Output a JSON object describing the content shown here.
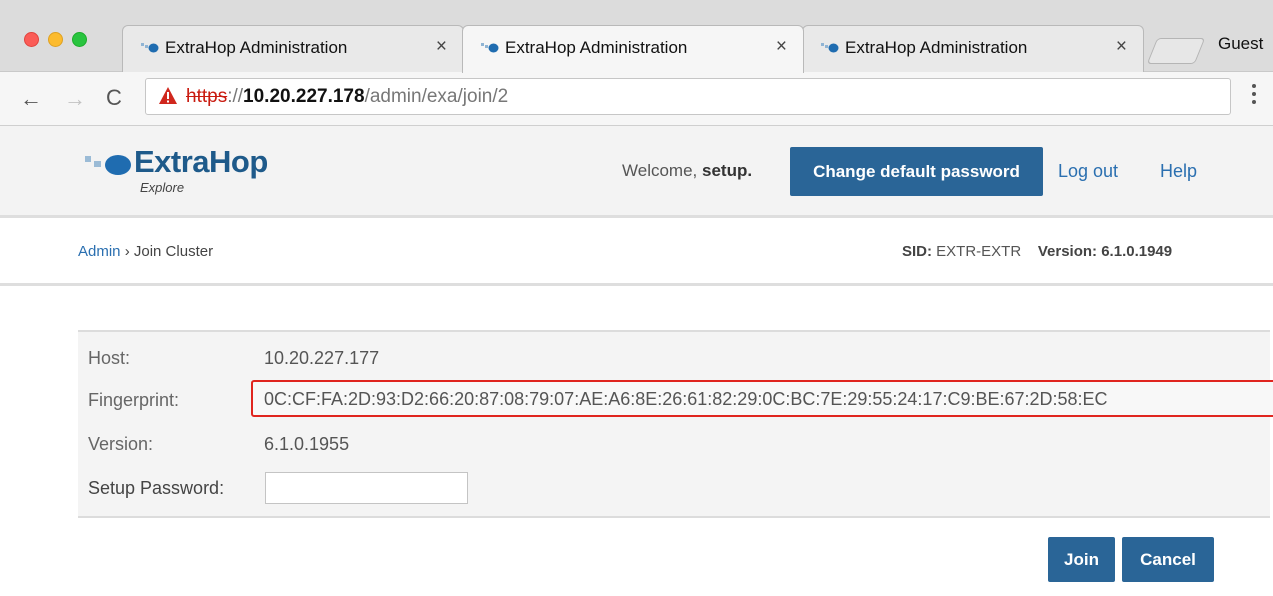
{
  "browser": {
    "tabs": [
      {
        "title": "ExtraHop Administration",
        "close": "×"
      },
      {
        "title": "ExtraHop Administration",
        "close": "×"
      },
      {
        "title": "ExtraHop Administration",
        "close": "×"
      }
    ],
    "profile": "Guest",
    "nav": {
      "back": "←",
      "forward": "→",
      "reload": "C"
    },
    "url": {
      "scheme": "https",
      "sep": "://",
      "host": "10.20.227.178",
      "path": "/admin/exa/join/2"
    }
  },
  "header": {
    "brand": "ExtraHop",
    "brand_sub": "Explore",
    "welcome_prefix": "Welcome, ",
    "welcome_user": "setup.",
    "change_password": "Change default password",
    "logout": "Log out",
    "help": "Help"
  },
  "breadcrumb": {
    "root": "Admin",
    "sep": " › ",
    "current": "Join Cluster"
  },
  "system": {
    "sid_label": "SID:",
    "sid_value": "EXTR-EXTR",
    "version_label": "Version:",
    "version_value": "6.1.0.1949"
  },
  "form": {
    "host_label": "Host:",
    "host_value": "10.20.227.177",
    "fingerprint_label": "Fingerprint:",
    "fingerprint_value": "0C:CF:FA:2D:93:D2:66:20:87:08:79:07:AE:A6:8E:26:61:82:29:0C:BC:7E:29:55:24:17:C9:BE:67:2D:58:EC",
    "version_label": "Version:",
    "version_value": "6.1.0.1955",
    "password_label": "Setup Password:",
    "password_value": ""
  },
  "actions": {
    "join": "Join",
    "cancel": "Cancel"
  },
  "colors": {
    "primary_button": "#2a6597",
    "link": "#2a6fb0",
    "highlight_border": "#e0251f",
    "brand_blue": "#1e5a8a"
  }
}
